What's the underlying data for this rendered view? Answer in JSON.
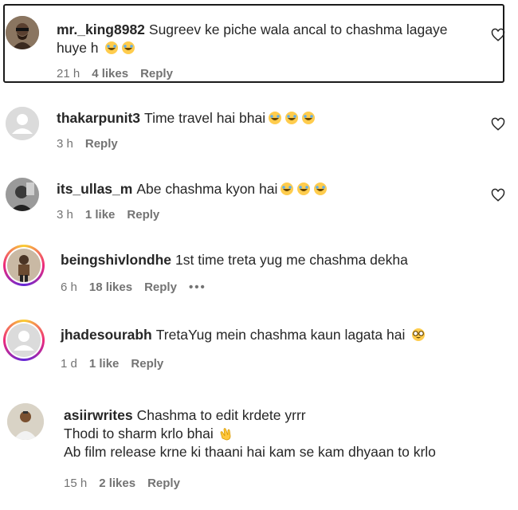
{
  "comments": [
    {
      "username": "mr._king8982",
      "lines": [
        "Sugreev ke piche wala ancal to chashma lagaye",
        "huye h"
      ],
      "emoji_after_last_line": [
        "laughing-tears-emoji",
        "laughing-tears-emoji"
      ],
      "time": "21 h",
      "likes": "4 likes",
      "reply": "Reply",
      "avatar_icon": "profile-photo",
      "highlighted": true
    },
    {
      "username": "thakarpunit3",
      "lines": [
        "Time travel hai bhai"
      ],
      "emoji_after_last_line": [
        "laughing-tears-emoji",
        "laughing-tears-emoji",
        "laughing-tears-emoji"
      ],
      "time": "3 h",
      "likes": "",
      "reply": "Reply",
      "avatar_icon": "default-avatar"
    },
    {
      "username": "its_ullas_m",
      "lines": [
        "Abe chashma kyon hai"
      ],
      "emoji_after_last_line": [
        "laughing-tears-emoji",
        "laughing-tears-emoji",
        "laughing-tears-emoji"
      ],
      "time": "3 h",
      "likes": "1 like",
      "reply": "Reply",
      "avatar_icon": "profile-photo"
    },
    {
      "username": "beingshivlondhe",
      "lines": [
        "1st time treta yug me chashma dekha"
      ],
      "emoji_after_last_line": [],
      "time": "6 h",
      "likes": "18 likes",
      "reply": "Reply",
      "more": "•••",
      "avatar_icon": "profile-photo-story-ring"
    },
    {
      "username": "jhadesourabh",
      "lines": [
        "TretaYug mein chashma kaun lagata hai"
      ],
      "emoji_after_last_line": [
        "nerd-face-emoji"
      ],
      "time": "1 d",
      "likes": "1 like",
      "reply": "Reply",
      "avatar_icon": "default-avatar-story-ring"
    },
    {
      "username": "asiirwrites",
      "lines": [
        "Chashma to edit krdete yrrr",
        "Thodi to sharm krlo bhai",
        "Ab film release krne ki thaani hai kam se kam dhyaan to krlo"
      ],
      "emoji_line2": [
        "clapping-hands-emoji"
      ],
      "time": "15 h",
      "likes": "2 likes",
      "reply": "Reply",
      "avatar_icon": "profile-photo"
    }
  ],
  "colors": {
    "text": "#262626",
    "meta": "#737373",
    "default_avatar_bg": "#dbdbdb",
    "highlight_border": "#1a1a1a"
  }
}
